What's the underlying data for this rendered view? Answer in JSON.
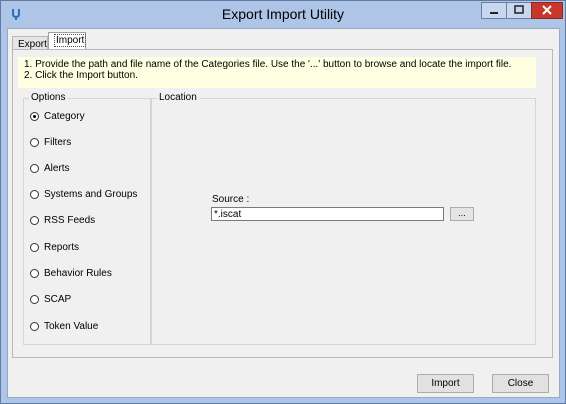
{
  "window": {
    "title": "Export Import Utility"
  },
  "tabs": [
    {
      "label": "Export",
      "active": false
    },
    {
      "label": "Import",
      "active": true
    }
  ],
  "instructions": {
    "line1": "1. Provide the path and file name of the Categories file. Use the '...' button to browse and locate the import file.",
    "line2": "2. Click the Import button."
  },
  "options": {
    "legend": "Options",
    "items": [
      {
        "label": "Category",
        "selected": true
      },
      {
        "label": "Filters",
        "selected": false
      },
      {
        "label": "Alerts",
        "selected": false
      },
      {
        "label": "Systems and Groups",
        "selected": false
      },
      {
        "label": "RSS Feeds",
        "selected": false
      },
      {
        "label": "Reports",
        "selected": false
      },
      {
        "label": "Behavior Rules",
        "selected": false
      },
      {
        "label": "SCAP",
        "selected": false
      },
      {
        "label": "Token Value",
        "selected": false
      }
    ]
  },
  "location": {
    "legend": "Location",
    "source_label": "Source :",
    "source_value": "*.iscat",
    "browse_label": "..."
  },
  "buttons": {
    "import": "Import",
    "close": "Close"
  },
  "colors": {
    "title_bar": "#aec5e8",
    "info_background": "#ffffe1",
    "close_button": "#c7372c"
  }
}
